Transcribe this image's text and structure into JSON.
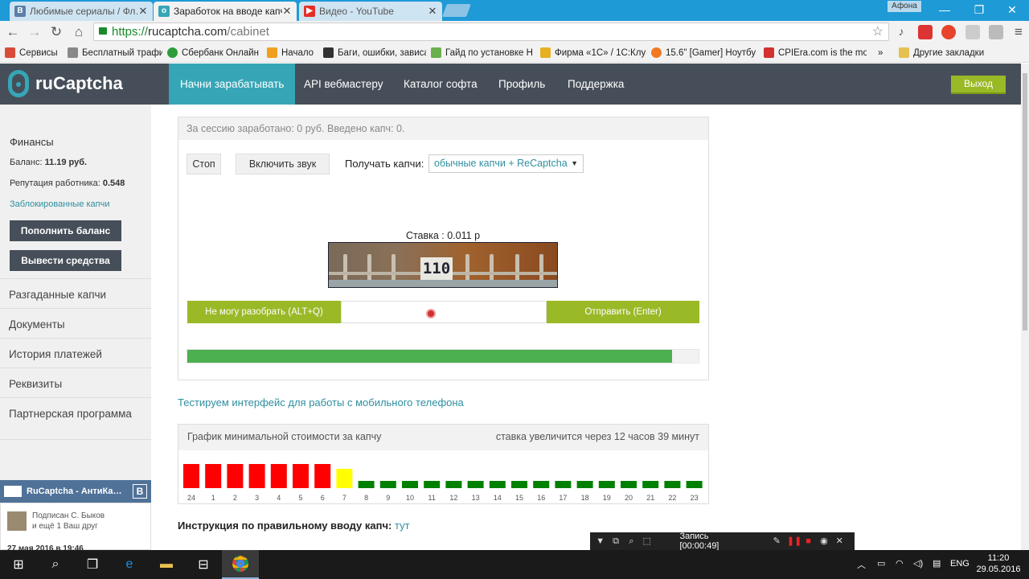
{
  "browser": {
    "tabs": [
      {
        "label": "Любимые сериалы / Фл…",
        "icon": "vk-icon",
        "color": "#5b7fa6",
        "active": false
      },
      {
        "label": "Заработок на вводе капч",
        "icon": "rucaptcha-icon",
        "color": "#36a6b7",
        "active": true
      },
      {
        "label": "Видео - YouTube",
        "icon": "youtube-icon",
        "color": "#e52d27",
        "active": false
      }
    ],
    "user_badge": "Афона",
    "url": {
      "scheme": "https://",
      "host": "rucaptcha.com",
      "path": "/cabinet"
    },
    "bookmarks": [
      {
        "label": "Сервисы",
        "color": "#d94b3a"
      },
      {
        "label": "Бесплатный трафик.",
        "color": "#888888"
      },
      {
        "label": "Сбербанк Онлайн",
        "color": "#2e9b3a"
      },
      {
        "label": "Начало",
        "color": "#f0a020"
      },
      {
        "label": "Баги, ошибки, зависа",
        "color": "#333333"
      },
      {
        "label": "Гайд по установке Н",
        "color": "#6ab04c"
      },
      {
        "label": "Фирма «1С» / 1С:Клу",
        "color": "#e6b020"
      },
      {
        "label": "15.6\" [Gamer] Ноутбу",
        "color": "#f07820"
      },
      {
        "label": "CPIEra.com is the mo",
        "color": "#d33030"
      }
    ],
    "bookmarks_more": "»",
    "other_bookmarks": "Другие закладки"
  },
  "header": {
    "logo": "ruCaptcha",
    "menu": [
      "Начни зарабатывать",
      "API вебмастеру",
      "Каталог софта",
      "Профиль",
      "Поддержка"
    ],
    "exit": "Выход"
  },
  "sidebar": {
    "finance_title": "Финансы",
    "balance_label": "Баланс: ",
    "balance_value": "11.19 руб.",
    "reputation_label": "Репутация работника: ",
    "reputation_value": "0.548",
    "blocked_link": "Заблокированные капчи",
    "topup_button": "Пополнить баланс",
    "withdraw_button": "Вывести средства",
    "items": [
      "Разгаданные капчи",
      "Документы",
      "История платежей",
      "Реквизиты",
      "Партнерская программа"
    ],
    "vk_widget": {
      "title": "RuCaptcha - АнтиКа…",
      "subscriber_text": "Подписан С. Быков",
      "subscriber_more": "и ещё 1 Ваш друг",
      "date": "27 мая 2016 в 19:46"
    }
  },
  "main": {
    "session_text": "За сессию заработано: 0 руб. Введено капч: 0.",
    "stop_button": "Стоп",
    "sound_button": "Включить звук",
    "receive_label": "Получать капчи:",
    "receive_value": "обычные капчи + ReCaptcha",
    "rate_text": "Ставка : 0.011 р",
    "captcha_text": "110",
    "cant_button": "Не могу разобрать  (ALT+Q)",
    "answer_value": "",
    "send_button": "Отправить (Enter)",
    "progress_fraction": 0.948,
    "mobile_link": "Тестируем интерфейс для работы с мобильного телефона",
    "instruction_label": "Инструкция по правильному вводу капч:",
    "instruction_link": "тут"
  },
  "chart_header": {
    "title": "График минимальной стоимости за капчу",
    "note": "ставка увеличится через 12 часов 39 минут"
  },
  "chart_data": {
    "type": "bar",
    "categories": [
      "24",
      "1",
      "2",
      "3",
      "4",
      "5",
      "6",
      "7",
      "8",
      "9",
      "10",
      "11",
      "12",
      "13",
      "14",
      "15",
      "16",
      "17",
      "18",
      "19",
      "20",
      "21",
      "22",
      "23"
    ],
    "levels": [
      "high",
      "high",
      "high",
      "high",
      "high",
      "high",
      "high",
      "medium",
      "low",
      "low",
      "low",
      "low",
      "low",
      "low",
      "low",
      "low",
      "low",
      "low",
      "low",
      "low",
      "low",
      "low",
      "low",
      "low"
    ],
    "colors": {
      "high": "#ff0000",
      "medium": "#ffff00",
      "low": "#008000"
    }
  },
  "recorder": {
    "label": "Запись [00:00:49]"
  },
  "taskbar": {
    "language": "ENG",
    "time": "11:20",
    "date": "29.05.2016"
  }
}
